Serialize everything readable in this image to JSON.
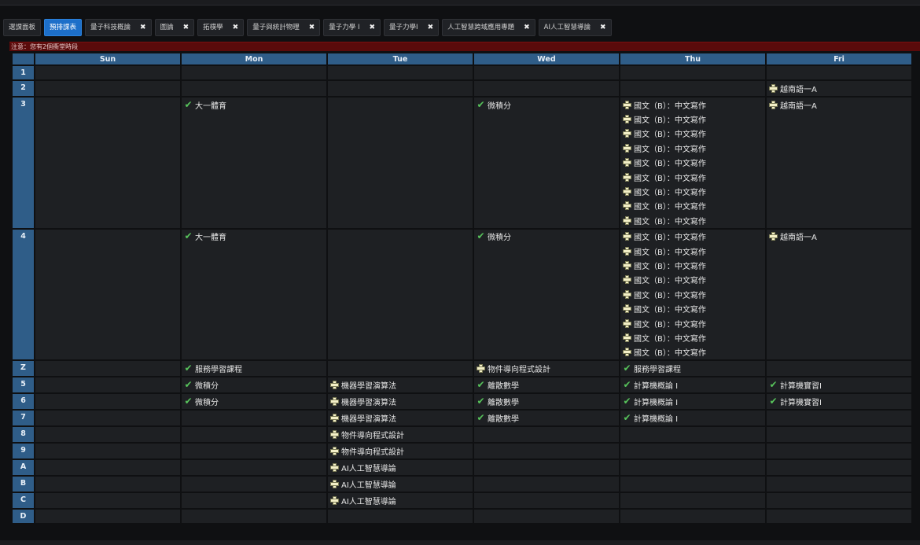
{
  "tabs": [
    {
      "label": "選課面板",
      "closable": false,
      "active": false
    },
    {
      "label": "預排課表",
      "closable": false,
      "active": true
    },
    {
      "label": "量子科技概論",
      "closable": true,
      "active": false
    },
    {
      "label": "圖論",
      "closable": true,
      "active": false
    },
    {
      "label": "拓樸學",
      "closable": true,
      "active": false
    },
    {
      "label": "量子與統計物理",
      "closable": true,
      "active": false
    },
    {
      "label": "量子力學 I",
      "closable": true,
      "active": false
    },
    {
      "label": "量子力學I",
      "closable": true,
      "active": false
    },
    {
      "label": "人工智慧跨域應用專題",
      "closable": true,
      "active": false
    },
    {
      "label": "AI人工智慧導論",
      "closable": true,
      "active": false
    }
  ],
  "close_glyph": "✖",
  "notice": "注意：您有2個衝堂時段",
  "days": [
    "Sun",
    "Mon",
    "Tue",
    "Wed",
    "Thu",
    "Fri"
  ],
  "colors": {
    "header": "#2f5d88",
    "conflict": "#6e1414",
    "active_tab": "#1d6fc9"
  },
  "periods": [
    {
      "label": "1",
      "cells": [
        [],
        [],
        [],
        [],
        [],
        []
      ]
    },
    {
      "label": "2",
      "cells": [
        [],
        [],
        [],
        [],
        [],
        [
          {
            "t": "越南語一A",
            "i": "plus"
          }
        ]
      ]
    },
    {
      "label": "3",
      "cells": [
        [],
        [
          {
            "t": "大一體育",
            "i": "check"
          }
        ],
        [],
        [
          {
            "t": "微積分",
            "i": "check"
          }
        ],
        [
          {
            "t": "國文（B）：中文寫作",
            "i": "plus"
          },
          {
            "t": "國文（B）：中文寫作",
            "i": "plus"
          },
          {
            "t": "國文（B）：中文寫作",
            "i": "plus"
          },
          {
            "t": "國文（B）：中文寫作",
            "i": "plus"
          },
          {
            "t": "國文（B）：中文寫作",
            "i": "plus"
          },
          {
            "t": "國文（B）：中文寫作",
            "i": "plus"
          },
          {
            "t": "國文（B）：中文寫作",
            "i": "plus"
          },
          {
            "t": "國文（B）：中文寫作",
            "i": "plus"
          },
          {
            "t": "國文（B）：中文寫作",
            "i": "plus"
          }
        ],
        [
          {
            "t": "越南語一A",
            "i": "plus"
          }
        ]
      ],
      "conflict": [
        false,
        false,
        false,
        false,
        true,
        false
      ]
    },
    {
      "label": "4",
      "cells": [
        [],
        [
          {
            "t": "大一體育",
            "i": "check"
          }
        ],
        [],
        [
          {
            "t": "微積分",
            "i": "check"
          }
        ],
        [
          {
            "t": "國文（B）：中文寫作",
            "i": "plus"
          },
          {
            "t": "國文（B）：中文寫作",
            "i": "plus"
          },
          {
            "t": "國文（B）：中文寫作",
            "i": "plus"
          },
          {
            "t": "國文（B）：中文寫作",
            "i": "plus"
          },
          {
            "t": "國文（B）：中文寫作",
            "i": "plus"
          },
          {
            "t": "國文（B）：中文寫作",
            "i": "plus"
          },
          {
            "t": "國文（B）：中文寫作",
            "i": "plus"
          },
          {
            "t": "國文（B）：中文寫作",
            "i": "plus"
          },
          {
            "t": "國文（B）：中文寫作",
            "i": "plus"
          }
        ],
        [
          {
            "t": "越南語一A",
            "i": "plus"
          }
        ]
      ],
      "conflict": [
        false,
        false,
        false,
        false,
        true,
        false
      ]
    },
    {
      "label": "Z",
      "cells": [
        [],
        [
          {
            "t": "服務學習課程",
            "i": "check"
          }
        ],
        [],
        [
          {
            "t": "物件導向程式設計",
            "i": "plus"
          }
        ],
        [
          {
            "t": "服務學習課程",
            "i": "check"
          }
        ],
        []
      ]
    },
    {
      "label": "5",
      "cells": [
        [],
        [
          {
            "t": "微積分",
            "i": "check"
          }
        ],
        [
          {
            "t": "機器學習演算法",
            "i": "plus"
          }
        ],
        [
          {
            "t": "離散數學",
            "i": "check"
          }
        ],
        [
          {
            "t": "計算機概論 I",
            "i": "check"
          }
        ],
        [
          {
            "t": "計算機實習I",
            "i": "check"
          }
        ]
      ]
    },
    {
      "label": "6",
      "cells": [
        [],
        [
          {
            "t": "微積分",
            "i": "check"
          }
        ],
        [
          {
            "t": "機器學習演算法",
            "i": "plus"
          }
        ],
        [
          {
            "t": "離散數學",
            "i": "check"
          }
        ],
        [
          {
            "t": "計算機概論 I",
            "i": "check"
          }
        ],
        [
          {
            "t": "計算機實習I",
            "i": "check"
          }
        ]
      ]
    },
    {
      "label": "7",
      "cells": [
        [],
        [],
        [
          {
            "t": "機器學習演算法",
            "i": "plus"
          }
        ],
        [
          {
            "t": "離散數學",
            "i": "check"
          }
        ],
        [
          {
            "t": "計算機概論 I",
            "i": "check"
          }
        ],
        []
      ]
    },
    {
      "label": "8",
      "cells": [
        [],
        [],
        [
          {
            "t": "物件導向程式設計",
            "i": "plus"
          }
        ],
        [],
        [],
        []
      ]
    },
    {
      "label": "9",
      "cells": [
        [],
        [],
        [
          {
            "t": "物件導向程式設計",
            "i": "plus"
          }
        ],
        [],
        [],
        []
      ]
    },
    {
      "label": "A",
      "cells": [
        [],
        [],
        [
          {
            "t": "AI人工智慧導論",
            "i": "plus"
          }
        ],
        [],
        [],
        []
      ]
    },
    {
      "label": "B",
      "cells": [
        [],
        [],
        [
          {
            "t": "AI人工智慧導論",
            "i": "plus"
          }
        ],
        [],
        [],
        []
      ]
    },
    {
      "label": "C",
      "cells": [
        [],
        [],
        [
          {
            "t": "AI人工智慧導論",
            "i": "plus"
          }
        ],
        [],
        [],
        []
      ]
    },
    {
      "label": "D",
      "cells": [
        [],
        [],
        [],
        [],
        [],
        []
      ]
    }
  ]
}
